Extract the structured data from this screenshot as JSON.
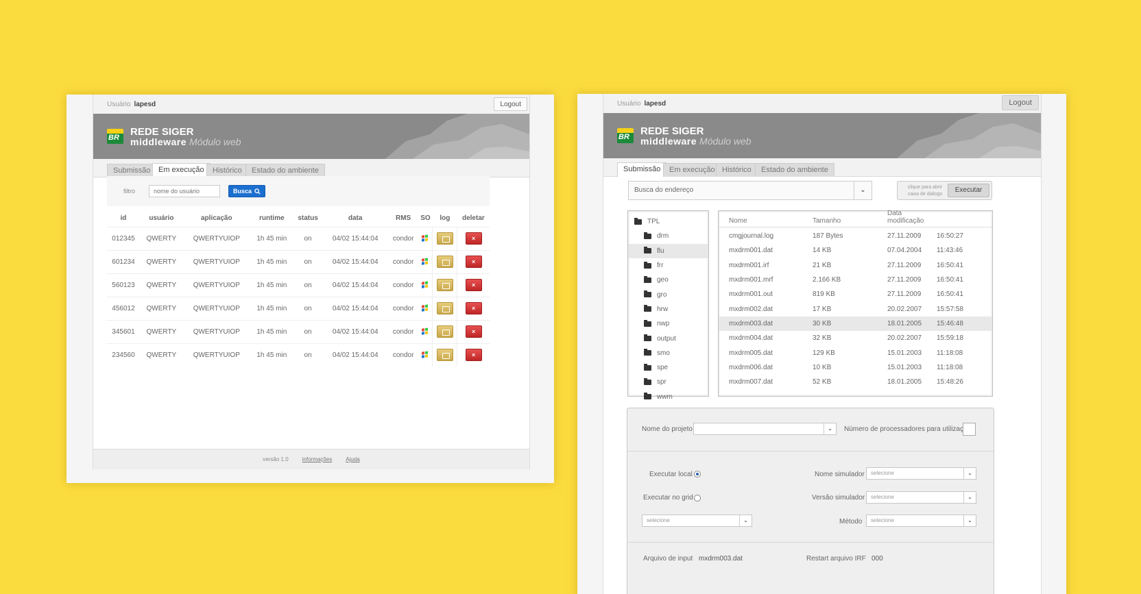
{
  "brand": {
    "line1": "REDE SIGER",
    "line2": "middleware",
    "line3": "Módulo web",
    "logo_text": "BR"
  },
  "shot1": {
    "user_label": "Usuário",
    "user_name": "lapesd",
    "logout": "Logout",
    "tabs": [
      "Submissão",
      "Em execução",
      "Histórico",
      "Estado do ambiente"
    ],
    "filter_label": "filtro",
    "filter_placeholder": "nome do usuário",
    "search_button": "Busca",
    "columns": [
      "id",
      "usuário",
      "aplicação",
      "runtime",
      "status",
      "data",
      "RMS",
      "SO",
      "log",
      "deletar"
    ],
    "rows": [
      [
        "012345",
        "QWERTY",
        "QWERTYUIOP",
        "1h 45 min",
        "on",
        "04/02 15:44:04",
        "condor"
      ],
      [
        "601234",
        "QWERTY",
        "QWERTYUIOP",
        "1h 45 min",
        "on",
        "04/02 15:44:04",
        "condor"
      ],
      [
        "560123",
        "QWERTY",
        "QWERTYUIOP",
        "1h 45 min",
        "on",
        "04/02 15:44:04",
        "condor"
      ],
      [
        "456012",
        "QWERTY",
        "QWERTYUIOP",
        "1h 45 min",
        "on",
        "04/02 15:44:04",
        "condor"
      ],
      [
        "345601",
        "QWERTY",
        "QWERTYUIOP",
        "1h 45 min",
        "on",
        "04/02 15:44:04",
        "condor"
      ],
      [
        "234560",
        "QWERTY",
        "QWERTYUIOP",
        "1h 45 min",
        "on",
        "04/02 15:44:04",
        "condor"
      ]
    ],
    "delete_glyph": "×",
    "footer": {
      "version": "versão 1.0",
      "info": "informações",
      "help": "Ajuda"
    }
  },
  "shot2": {
    "user_label": "Usuário",
    "user_name": "lapesd",
    "logout": "Logout",
    "tabs": [
      "Submissão",
      "Em execução",
      "Histórico",
      "Estado do ambiente"
    ],
    "address_placeholder": "Busca do endereço",
    "dialog_hint": "clique para abrir caixa de diálogo",
    "execute_button": "Executar",
    "tree": [
      "TPL",
      "drm",
      "flu",
      "frr",
      "geo",
      "gro",
      "hrw",
      "nwp",
      "output",
      "smo",
      "spe",
      "spr",
      "wwm"
    ],
    "file_columns": [
      "Nome",
      "Tamanho",
      "Data modificação"
    ],
    "files": [
      [
        "cmgjournal.log",
        "187 Bytes",
        "27.11.2009",
        "16:50:27"
      ],
      [
        "mxdrm001.dat",
        "14 KB",
        "07.04.2004",
        "11:43:46"
      ],
      [
        "mxdrm001.irf",
        "21 KB",
        "27.11.2009",
        "16:50:41"
      ],
      [
        "mxdrm001.mrf",
        "2.166 KB",
        "27.11.2009",
        "16:50:41"
      ],
      [
        "mxdrm001.out",
        "819 KB",
        "27.11.2009",
        "16:50:41"
      ],
      [
        "mxdrm002.dat",
        "17 KB",
        "20.02.2007",
        "15:57:58"
      ],
      [
        "mxdrm003.dat",
        "30 KB",
        "18.01.2005",
        "15:46:48"
      ],
      [
        "mxdrm004.dat",
        "32 KB",
        "20.02.2007",
        "15:59:18"
      ],
      [
        "mxdrm005.dat",
        "129 KB",
        "15.01.2003",
        "11:18:08"
      ],
      [
        "mxdrm006.dat",
        "10 KB",
        "15.01.2003",
        "11:18:08"
      ],
      [
        "mxdrm007.dat",
        "52 KB",
        "18.01.2005",
        "15:48:26"
      ]
    ],
    "form": {
      "project_name": "Nome do projeto",
      "processors": "Número de processadores para utilização",
      "run_local": "Executar local",
      "run_grid": "Executar no grid",
      "simulator_name": "Nome simulador",
      "simulator_version": "Versão simulador",
      "method": "Método",
      "select_placeholder": "selecione",
      "input_file_label": "Arquivo de input",
      "input_file_value": "mxdrm003.dat",
      "restart_label": "Restart arquivo IRF",
      "restart_value": "000"
    }
  },
  "colors": {
    "background": "#fbdc3e",
    "banner": "#8a8a8a",
    "search_blue": "#1b6fd0",
    "delete_red": "#c02626",
    "folder_gold": "#c9a84a"
  }
}
